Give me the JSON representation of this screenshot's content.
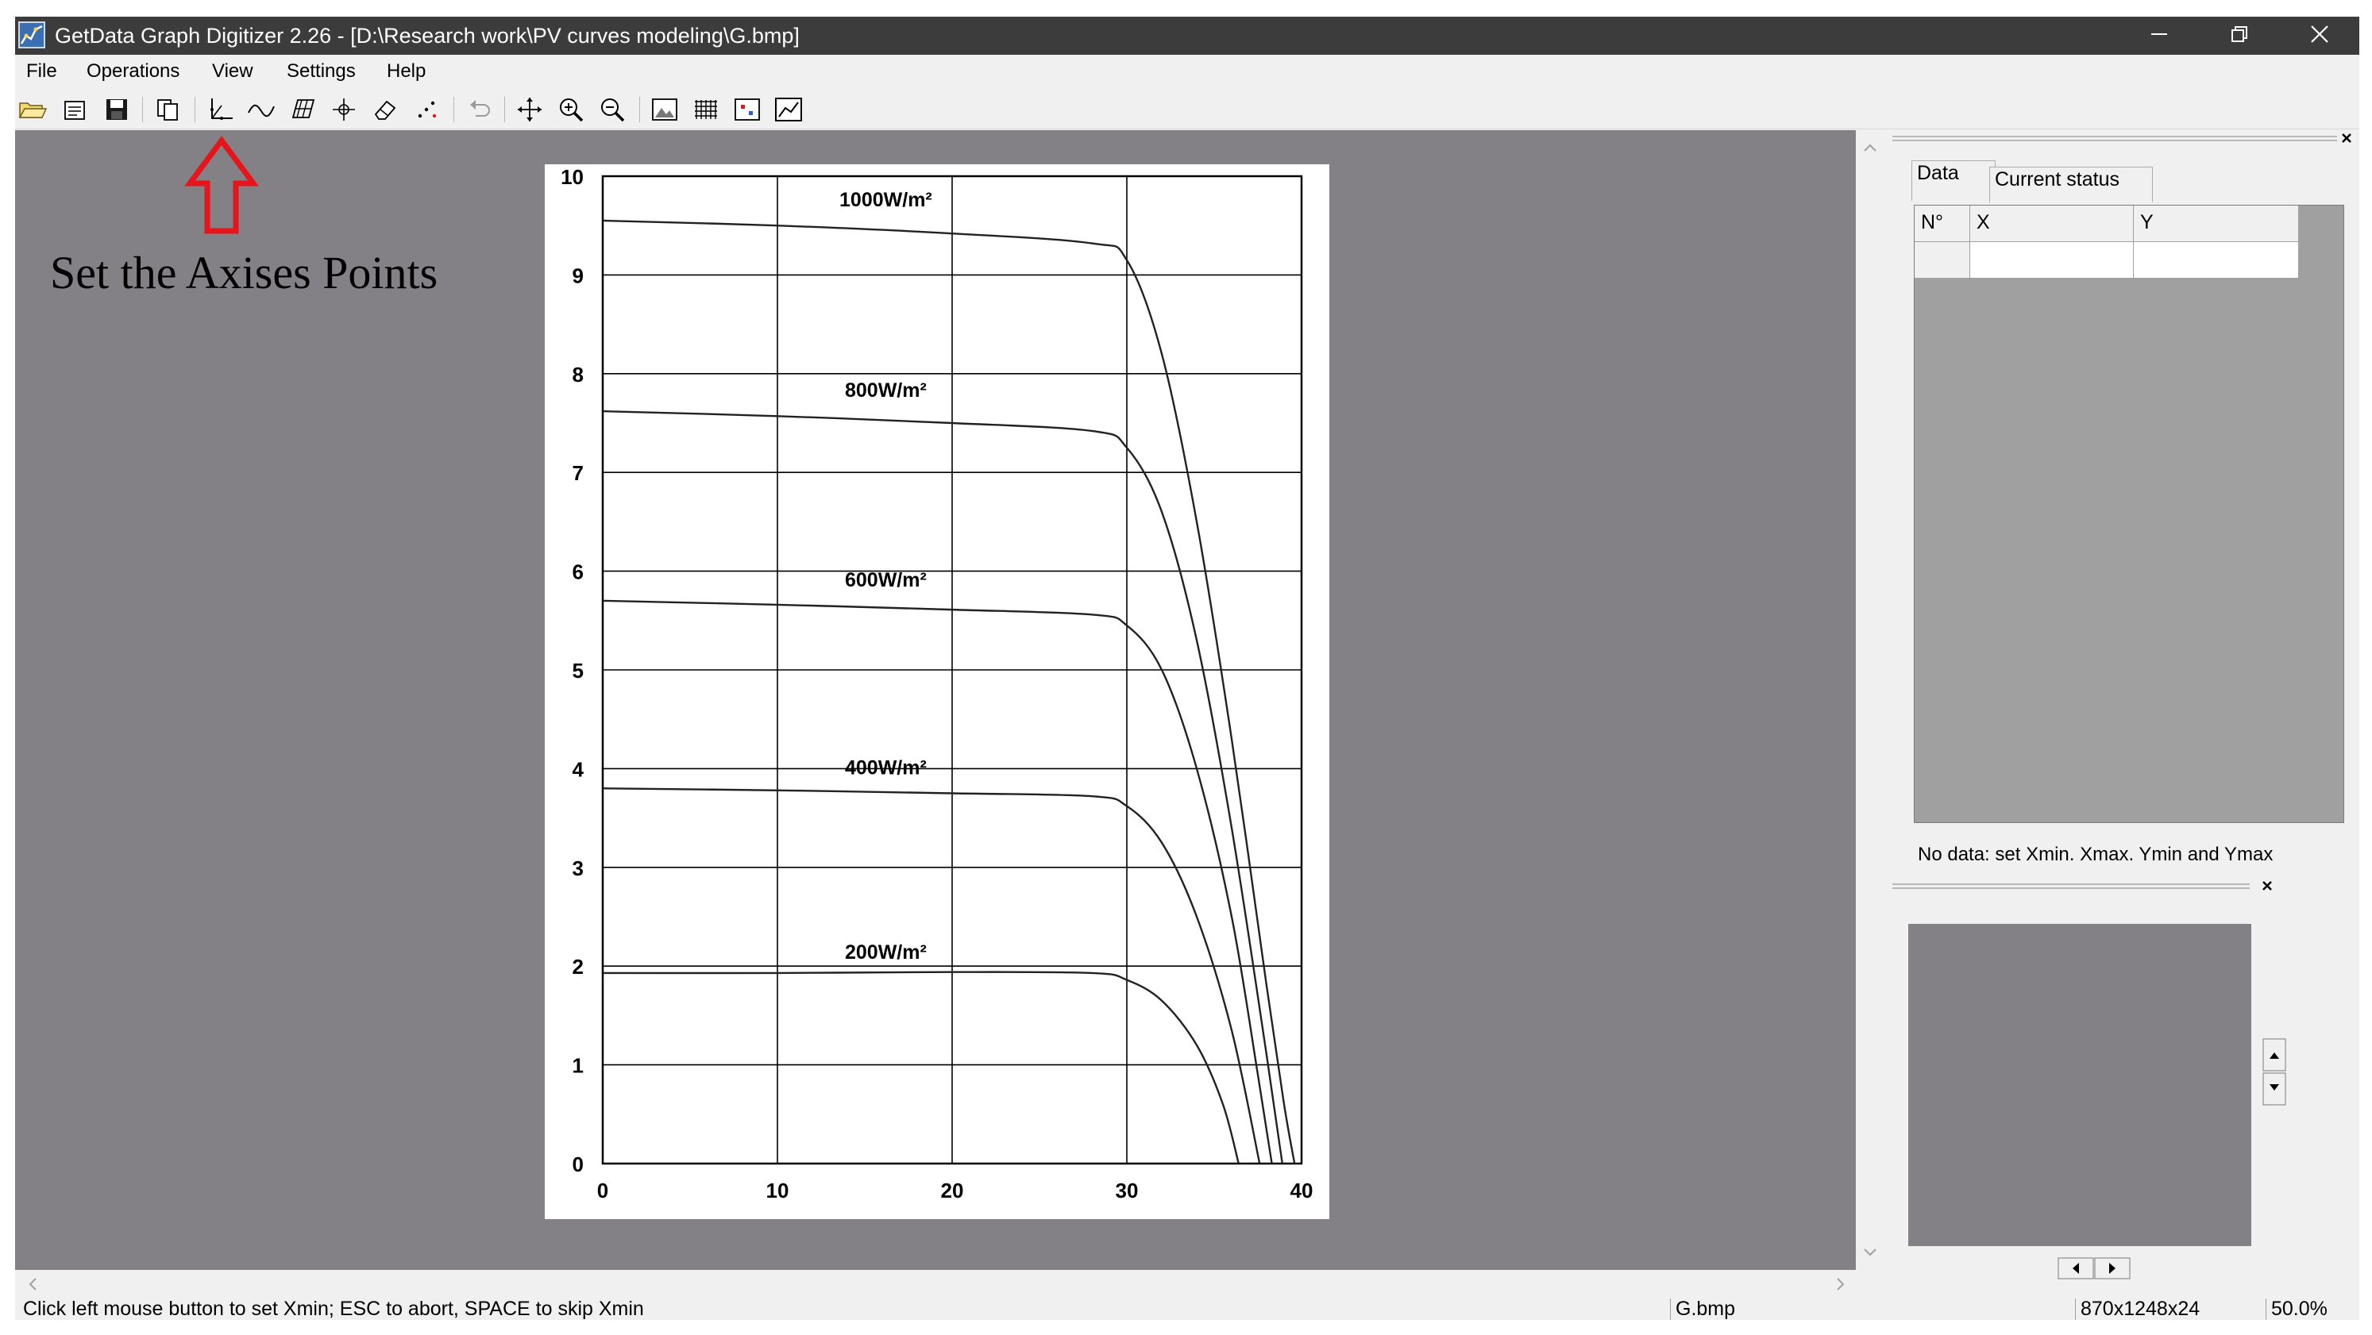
{
  "window": {
    "title": "GetData Graph Digitizer 2.26  - [D:\\Research work\\PV curves modeling\\G.bmp]"
  },
  "menu": [
    "File",
    "Operations",
    "View",
    "Settings",
    "Help"
  ],
  "toolbar": {
    "buttons": [
      {
        "icon": "open-folder-icon"
      },
      {
        "icon": "scan-icon"
      },
      {
        "icon": "save-icon"
      },
      {
        "icon": "copy-icon"
      },
      {
        "icon": "axis-points-icon"
      },
      {
        "icon": "auto-trace-lines-icon"
      },
      {
        "icon": "digitize-area-icon"
      },
      {
        "icon": "point-capture-icon"
      },
      {
        "icon": "eraser-icon"
      },
      {
        "icon": "point-set-icon"
      },
      {
        "icon": "undo-icon"
      },
      {
        "icon": "pan-icon"
      },
      {
        "icon": "zoom-in-icon"
      },
      {
        "icon": "zoom-out-icon"
      },
      {
        "icon": "show-image-icon"
      },
      {
        "icon": "grid-icon"
      },
      {
        "icon": "show-points-icon"
      },
      {
        "icon": "show-graph-icon"
      }
    ]
  },
  "annotation": {
    "text": "Set the Axises Points",
    "arrow_color": "#e8141c"
  },
  "chart_data": {
    "type": "line",
    "xlim": [
      0,
      40
    ],
    "ylim": [
      0,
      10
    ],
    "x_ticks": [
      "0",
      "10",
      "20",
      "30",
      "40"
    ],
    "y_ticks": [
      "0",
      "1",
      "2",
      "3",
      "4",
      "5",
      "6",
      "7",
      "8",
      "9",
      "10"
    ],
    "grid": true,
    "series": [
      {
        "name": "1000W/m²",
        "x": [
          0,
          10,
          20,
          28,
          30,
          32,
          34,
          36,
          38,
          39,
          39.6
        ],
        "y": [
          9.55,
          9.5,
          9.42,
          9.32,
          9.15,
          8.2,
          6.5,
          4.3,
          1.8,
          0.6,
          0
        ]
      },
      {
        "name": "800W/m²",
        "x": [
          0,
          10,
          20,
          28,
          30,
          32,
          34,
          36,
          38,
          38.9
        ],
        "y": [
          7.62,
          7.57,
          7.5,
          7.42,
          7.25,
          6.6,
          5.3,
          3.4,
          1.1,
          0
        ]
      },
      {
        "name": "600W/m²",
        "x": [
          0,
          10,
          20,
          28,
          30,
          32,
          34,
          36,
          37.5,
          38.3
        ],
        "y": [
          5.7,
          5.66,
          5.61,
          5.56,
          5.45,
          5.0,
          4.0,
          2.5,
          0.9,
          0
        ]
      },
      {
        "name": "400W/m²",
        "x": [
          0,
          10,
          20,
          28,
          30,
          32,
          34,
          36,
          37.6
        ],
        "y": [
          3.8,
          3.78,
          3.75,
          3.72,
          3.62,
          3.25,
          2.5,
          1.35,
          0
        ]
      },
      {
        "name": "200W/m²",
        "x": [
          0,
          10,
          20,
          28,
          30,
          32,
          34,
          35.5,
          36.4
        ],
        "y": [
          1.93,
          1.93,
          1.94,
          1.93,
          1.86,
          1.65,
          1.2,
          0.6,
          0
        ]
      }
    ]
  },
  "panel": {
    "tabs": [
      "Data",
      "Current status"
    ],
    "columns": [
      "N°",
      "X",
      "Y"
    ],
    "status": "No data: set Xmin, Xmax, Ymin and Ymax"
  },
  "status": {
    "message": "Click left mouse button to set Xmin; ESC to abort, SPACE to skip Xmin",
    "file": "G.bmp",
    "dims": "870x1248x24",
    "zoom": "50.0%"
  }
}
